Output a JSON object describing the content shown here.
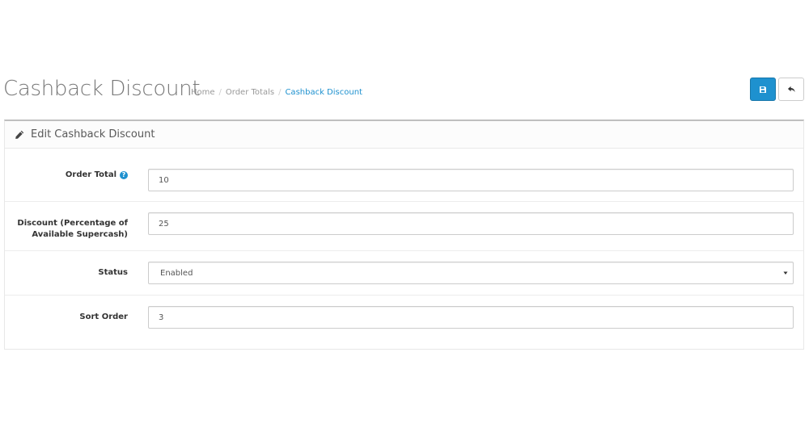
{
  "page": {
    "title": "Cashback Discount"
  },
  "breadcrumb": [
    {
      "label": "Home"
    },
    {
      "label": "Order Totals"
    },
    {
      "label": "Cashback Discount"
    }
  ],
  "actions": {
    "save_icon": "floppy-disk-icon",
    "back_icon": "reply-arrow-icon",
    "primary_color": "#1e91cf"
  },
  "panel": {
    "icon": "pencil-icon",
    "title": "Edit Cashback Discount"
  },
  "form": {
    "order_total": {
      "label": "Order Total",
      "value": "10",
      "help_icon": "question-circle-icon"
    },
    "discount": {
      "label_line1": "Discount (Percentage of",
      "label_line2": "Available Supercash)",
      "value": "25"
    },
    "status": {
      "label": "Status",
      "value": "Enabled"
    },
    "sort_order": {
      "label": "Sort Order",
      "value": "3"
    }
  }
}
